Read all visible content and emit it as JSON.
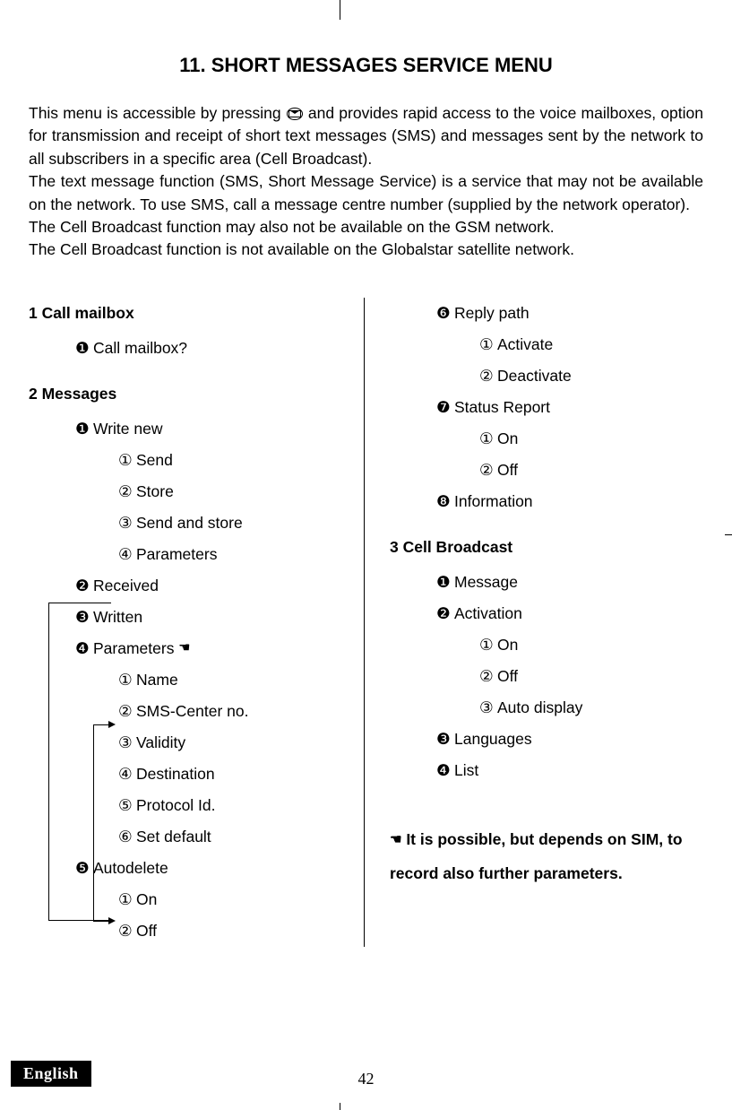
{
  "title": "11. SHORT MESSAGES SERVICE MENU",
  "intro": {
    "p1a": "This menu is accessible by pressing ",
    "p1b": " and provides rapid access to the voice mailboxes, option for transmission and receipt of short text messages (SMS) and messages sent by the network to all subscribers in a specific area (Cell Broadcast).",
    "p2": "The text message function (SMS, Short Message Service) is a service that may not be available on the network. To use SMS, call a message centre number (supplied by the network operator).",
    "p3": "The Cell Broadcast function may also not be available on the GSM network.",
    "p4": "The Cell Broadcast function is not available on the Globalstar satellite network."
  },
  "bullets": {
    "b1": "❶",
    "b2": "❷",
    "b3": "❸",
    "b4": "❹",
    "b5": "❺",
    "b6": "❻",
    "b7": "❼",
    "b8": "❽",
    "c1": "①",
    "c2": "②",
    "c3": "③",
    "c4": "④",
    "c5": "⑤",
    "c6": "⑥"
  },
  "menu": {
    "sec1": {
      "head": "1 Call mailbox",
      "i1": "Call mailbox?"
    },
    "sec2": {
      "head": "2 Messages",
      "i1": "Write new",
      "i1_1": "Send",
      "i1_2": "Store",
      "i1_3": "Send and store",
      "i1_4": "Parameters",
      "i2": "Received",
      "i3": "Written",
      "i4": "Parameters ",
      "i4_1": "Name",
      "i4_2": "SMS-Center no.",
      "i4_3": "Validity",
      "i4_4": "Destination",
      "i4_5": "Protocol Id.",
      "i4_6": "Set default",
      "i5": "Autodelete",
      "i5_1": "On",
      "i5_2": "Off",
      "i6": "Reply path",
      "i6_1": "Activate",
      "i6_2": "Deactivate",
      "i7": "Status Report",
      "i7_1": "On",
      "i7_2": "Off",
      "i8": "Information"
    },
    "sec3": {
      "head": "3 Cell Broadcast",
      "i1": "Message",
      "i2": "Activation",
      "i2_1": "On",
      "i2_2": "Off",
      "i2_3": "Auto display",
      "i3": "Languages",
      "i4": "List"
    }
  },
  "note": " It is possible, but depends on SIM, to record also further parameters.",
  "footer": {
    "lang": "English",
    "page": "42"
  },
  "hand_glyph": "☛"
}
